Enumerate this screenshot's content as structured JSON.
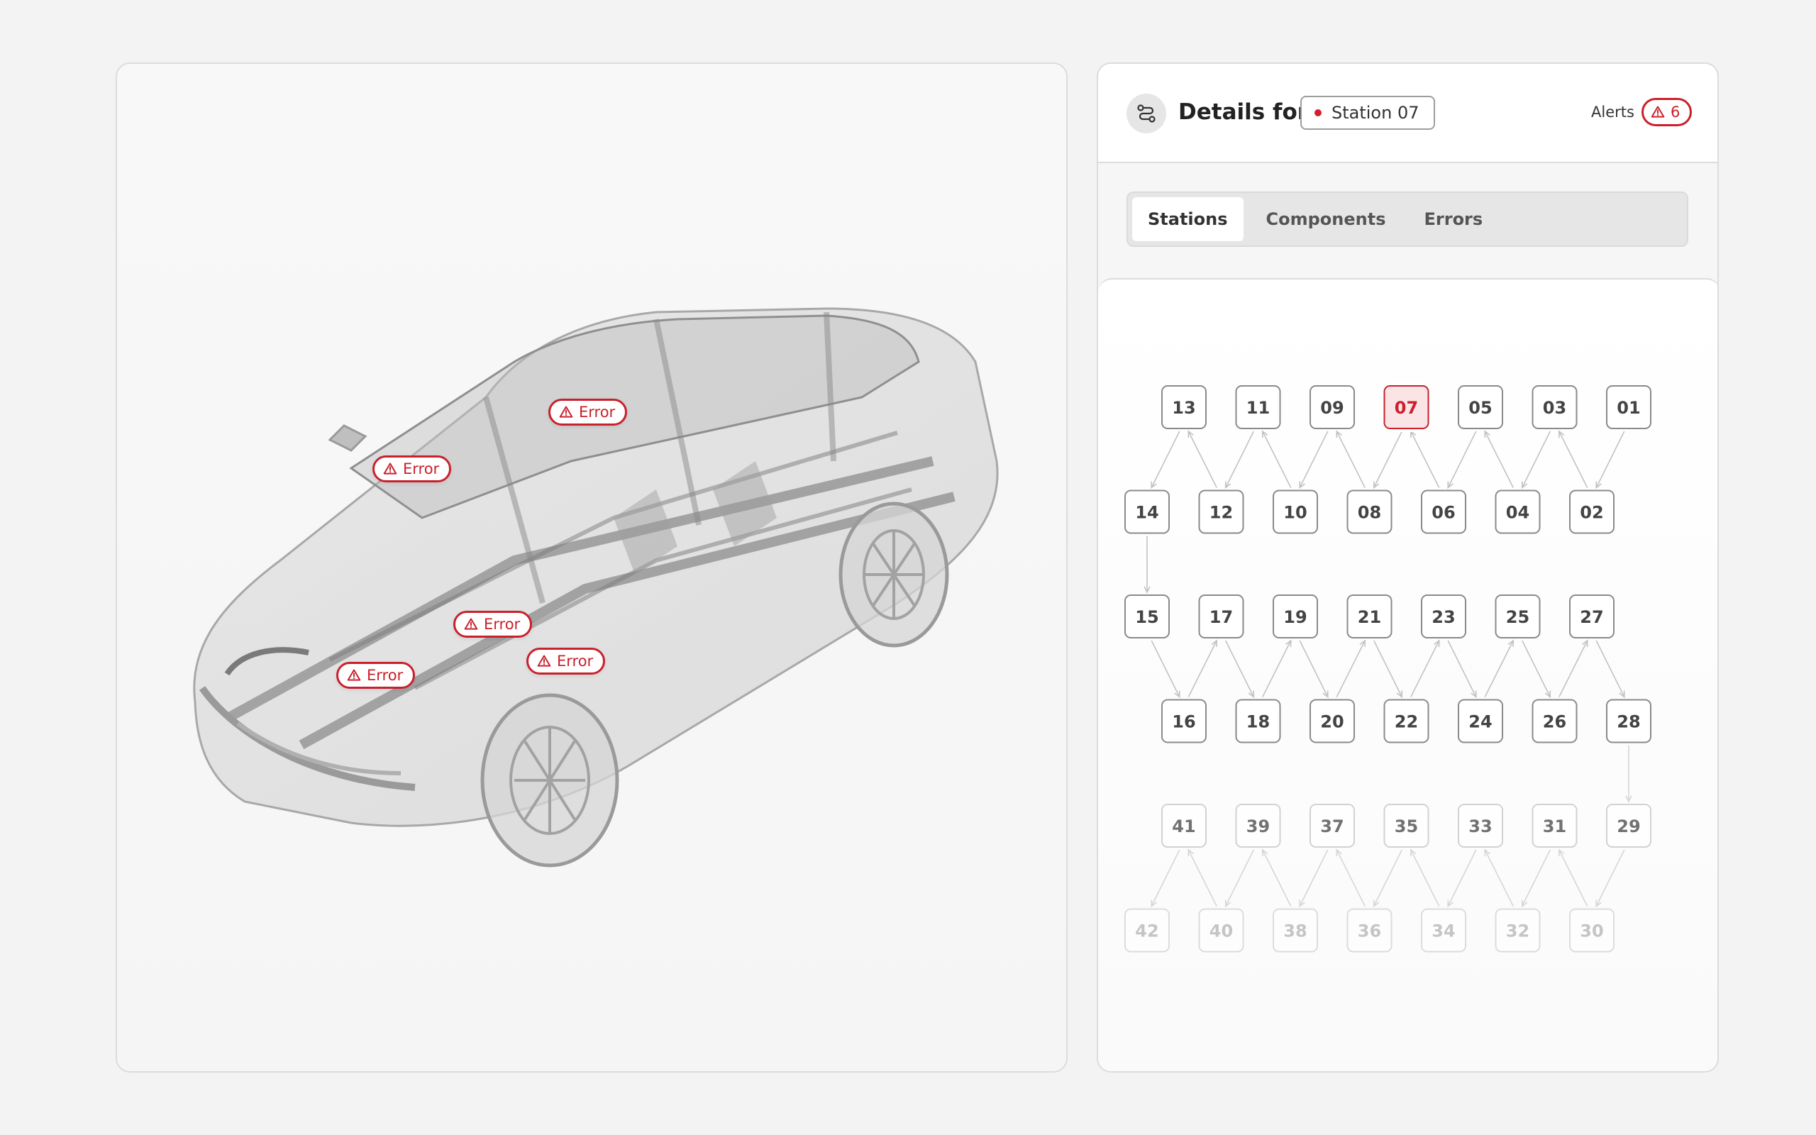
{
  "viewer": {
    "error_markers": [
      {
        "label": "Error"
      },
      {
        "label": "Error"
      },
      {
        "label": "Error"
      },
      {
        "label": "Error"
      },
      {
        "label": "Error"
      }
    ]
  },
  "details": {
    "title": "Details for",
    "selected_station": "Station 07",
    "alerts_label": "Alerts",
    "alerts_count": "6"
  },
  "tabs": [
    {
      "label": "Stations",
      "active": true
    },
    {
      "label": "Components",
      "active": false
    },
    {
      "label": "Errors",
      "active": false
    }
  ],
  "stations": {
    "rows": [
      [
        "13",
        "11",
        "09",
        "07",
        "05",
        "03",
        "01"
      ],
      [
        "14",
        "12",
        "10",
        "08",
        "06",
        "04",
        "02"
      ],
      [
        "15",
        "17",
        "19",
        "21",
        "23",
        "25",
        "27"
      ],
      [
        "16",
        "18",
        "20",
        "22",
        "24",
        "26",
        "28"
      ],
      [
        "41",
        "39",
        "37",
        "35",
        "33",
        "31",
        "29"
      ],
      [
        "42",
        "40",
        "38",
        "36",
        "34",
        "32",
        "30"
      ]
    ],
    "selected": "07"
  },
  "colors": {
    "accent": "#c9202c",
    "selected_fill": "#fbe4e6",
    "node_stroke": "#8a8a8a",
    "node_stroke_faded": "#c4c4c4"
  },
  "icons": {
    "header": "route-icon",
    "alert": "warning-triangle-icon"
  }
}
